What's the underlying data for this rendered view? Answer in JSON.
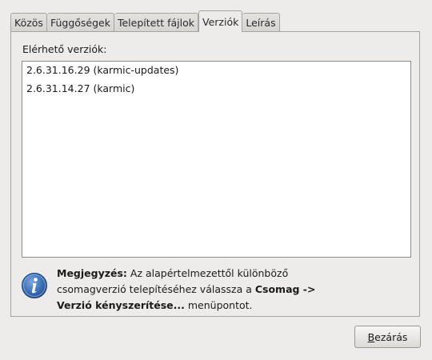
{
  "tabs": [
    {
      "label": "Közös",
      "active": false
    },
    {
      "label": "Függőségek",
      "active": false
    },
    {
      "label": "Telepített fájlok",
      "active": false
    },
    {
      "label": "Verziók",
      "active": true
    },
    {
      "label": "Leírás",
      "active": false
    }
  ],
  "panel": {
    "available_label": "Elérhető verziók:",
    "versions": [
      "2.6.31.16.29 (karmic-updates)",
      "2.6.31.14.27 (karmic)"
    ]
  },
  "note": {
    "icon": "info-icon",
    "bold_prefix": "Megjegyzés:",
    "text1": " Az alapértelmezettől különböző csomagverzió telepítéséhez válassza a ",
    "bold_menu": "Csomag -> Verzió kényszerítése...",
    "text2": " menüpontot."
  },
  "buttons": {
    "close_mnemonic": "B",
    "close_rest": "ezárás"
  },
  "colors": {
    "info_icon_blue": "#3b6fb6",
    "window_bg": "#edeceb"
  }
}
